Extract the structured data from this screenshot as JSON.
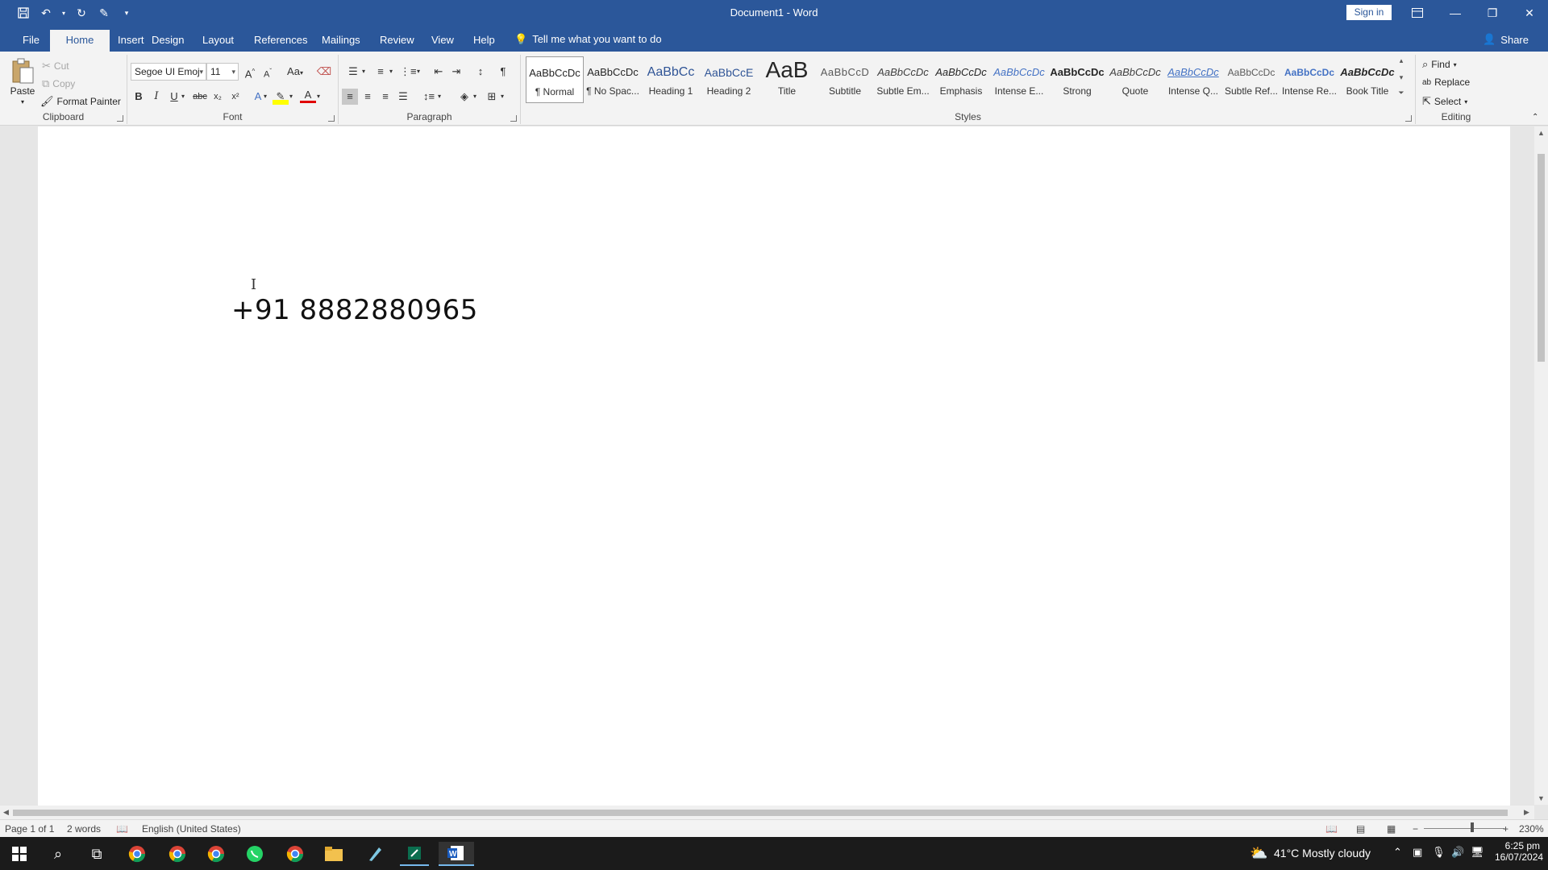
{
  "window": {
    "title": "Document1  -  Word",
    "sign_in": "Sign in",
    "share": "Share"
  },
  "tabs": [
    "File",
    "Home",
    "Insert",
    "Design",
    "Layout",
    "References",
    "Mailings",
    "Review",
    "View",
    "Help"
  ],
  "tell_me": "Tell me what you want to do",
  "clipboard": {
    "paste": "Paste",
    "cut": "Cut",
    "copy": "Copy",
    "format_painter": "Format Painter",
    "label": "Clipboard"
  },
  "font": {
    "name": "Segoe UI Emoj",
    "size": "11",
    "label": "Font",
    "change_case": "Aa",
    "grow": "A",
    "shrink": "A"
  },
  "paragraph": {
    "label": "Paragraph"
  },
  "styles": {
    "label": "Styles",
    "items": [
      {
        "preview": "AaBbCcDc",
        "name": "¶ Normal"
      },
      {
        "preview": "AaBbCcDc",
        "name": "¶ No Spac..."
      },
      {
        "preview": "AaBbCc",
        "name": "Heading 1"
      },
      {
        "preview": "AaBbCcE",
        "name": "Heading 2"
      },
      {
        "preview": "AaB",
        "name": "Title"
      },
      {
        "preview": "AaBbCcD",
        "name": "Subtitle"
      },
      {
        "preview": "AaBbCcDc",
        "name": "Subtle Em..."
      },
      {
        "preview": "AaBbCcDc",
        "name": "Emphasis"
      },
      {
        "preview": "AaBbCcDc",
        "name": "Intense E..."
      },
      {
        "preview": "AaBbCcDc",
        "name": "Strong"
      },
      {
        "preview": "AaBbCcDc",
        "name": "Quote"
      },
      {
        "preview": "AaBbCcDc",
        "name": "Intense Q..."
      },
      {
        "preview": "AaBbCcDc",
        "name": "Subtle Ref..."
      },
      {
        "preview": "AaBbCcDc",
        "name": "Intense Re..."
      },
      {
        "preview": "AaBbCcDc",
        "name": "Book Title"
      }
    ]
  },
  "editing": {
    "find": "Find",
    "replace": "Replace",
    "select": "Select",
    "label": "Editing"
  },
  "document": {
    "text": "+91 8882880965"
  },
  "status": {
    "page": "Page 1 of 1",
    "words": "2 words",
    "language": "English (United States)",
    "zoom": "230%"
  },
  "taskbar": {
    "weather": "41°C  Mostly cloudy",
    "time": "6:25 pm",
    "date": "16/07/2024"
  },
  "colors": {
    "brand": "#2b579a",
    "ribbon_bg": "#f3f3f3",
    "taskbar_bg": "#1b1b1b"
  }
}
